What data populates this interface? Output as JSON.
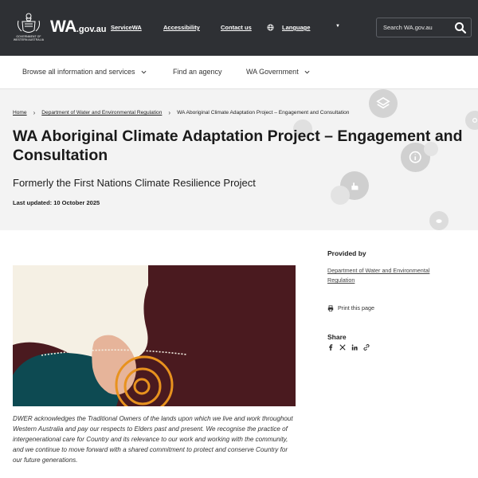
{
  "header": {
    "crest_caption": "GOVERNMENT OF WESTERN AUSTRALIA",
    "logo_wa": "WA",
    "logo_domain": ".gov.au",
    "links": [
      "ServiceWA",
      "Accessibility",
      "Contact us"
    ],
    "language_label": "Language",
    "search_placeholder": "Search WA.gov.au"
  },
  "nav": {
    "items": [
      "Browse all information and services",
      "Find an agency",
      "WA Government"
    ]
  },
  "hero": {
    "breadcrumb": [
      "Home",
      "Department of Water and Environmental Regulation",
      "WA Aboriginal Climate Adaptation Project – Engagement and Consultation"
    ],
    "title": "WA Aboriginal Climate Adaptation Project – Engagement and Consultation",
    "subtitle": "Formerly the First Nations Climate Resilience Project",
    "last_updated": "Last updated: 10 October 2025"
  },
  "main": {
    "caption": "DWER acknowledges the Traditional Owners of the lands upon which we live and work throughout Western Australia and pay our respects to Elders past and present. We recognise the practice of intergenerational care for Country and its relevance to our work and working with the community, and we continue to move forward with a shared commitment to protect and conserve Country for our future generations."
  },
  "sidebar": {
    "provided_by_heading": "Provided by",
    "provider_link": "Department of Water and Environmental Regulation",
    "print_label": "Print this page",
    "share_heading": "Share",
    "share_icons": [
      "facebook-icon",
      "x-icon",
      "linkedin-icon",
      "link-icon"
    ]
  },
  "colors": {
    "topbar": "#2e3034",
    "hero_bg": "#f3f3f3",
    "artwork_maroon": "#4a1a1f",
    "artwork_teal": "#0d4a52",
    "artwork_orange": "#e8921e",
    "artwork_peach": "#e6b49a",
    "artwork_cream": "#f5f0e4"
  }
}
